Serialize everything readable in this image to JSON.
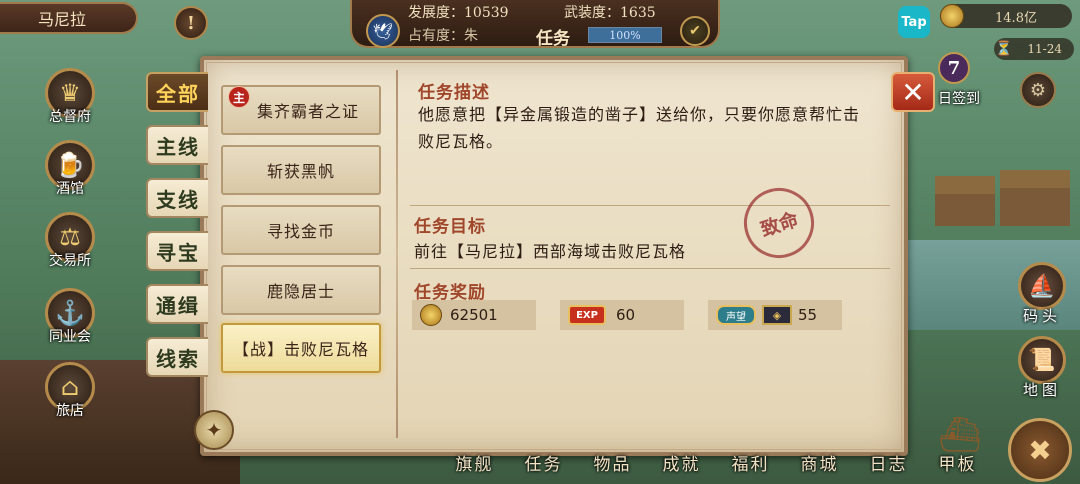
{
  "topbar": {
    "city": "马尼拉",
    "development": "发展度：10539",
    "military": "武装度：1635",
    "occupancy": "占有度：朱",
    "title": "任务",
    "progress_text": "100%",
    "progress_value": 100,
    "gold": "14.8亿",
    "date": "11-24",
    "tap_label": "Tap"
  },
  "left_buildings": [
    {
      "label": "总督府",
      "icon": "crown-icon"
    },
    {
      "label": "酒馆",
      "icon": "tavern-icon"
    },
    {
      "label": "交易所",
      "icon": "scales-icon"
    },
    {
      "label": "同业会",
      "icon": "anchor-icon"
    },
    {
      "label": "旅店",
      "icon": "inn-icon"
    }
  ],
  "right_buttons": {
    "signin_count": "7",
    "signin_label": "日签到",
    "dock": "码头",
    "map": "地图"
  },
  "categories": [
    "全部",
    "主线",
    "支线",
    "寻宝",
    "通缉",
    "线索"
  ],
  "active_category": "全部",
  "quests": [
    {
      "name": "集齐霸者之证",
      "badge": "主"
    },
    {
      "name": "斩获黑帆"
    },
    {
      "name": "寻找金币"
    },
    {
      "name": "鹿隐居士"
    },
    {
      "name": "【战】击败尼瓦格"
    }
  ],
  "selected_quest": "【战】击败尼瓦格",
  "detail": {
    "desc_title": "任务描述",
    "desc_text": "他愿意把【异金属锻造的凿子】送给你，只要你愿意帮忙击败尼瓦格。",
    "goal_title": "任务目标",
    "goal_text": "前往【马尼拉】西部海域击败尼瓦格",
    "stamp": "致命",
    "reward_title": "任务奖励",
    "rewards": [
      {
        "icon": "gold-coin-icon",
        "value": "62501"
      },
      {
        "icon": "exp-icon",
        "label": "EXP",
        "value": "60"
      },
      {
        "icon": "reputation-icon",
        "label": "声望",
        "value": "55"
      }
    ]
  },
  "bottom_nav": [
    "旗舰",
    "任务",
    "物品",
    "成就",
    "福利",
    "商城",
    "日志",
    "甲板"
  ],
  "colors": {
    "parchment": "#efe5cf",
    "accent_red": "#a0462a",
    "active_tab": "#6b4a28",
    "close_red": "#c8402a"
  }
}
